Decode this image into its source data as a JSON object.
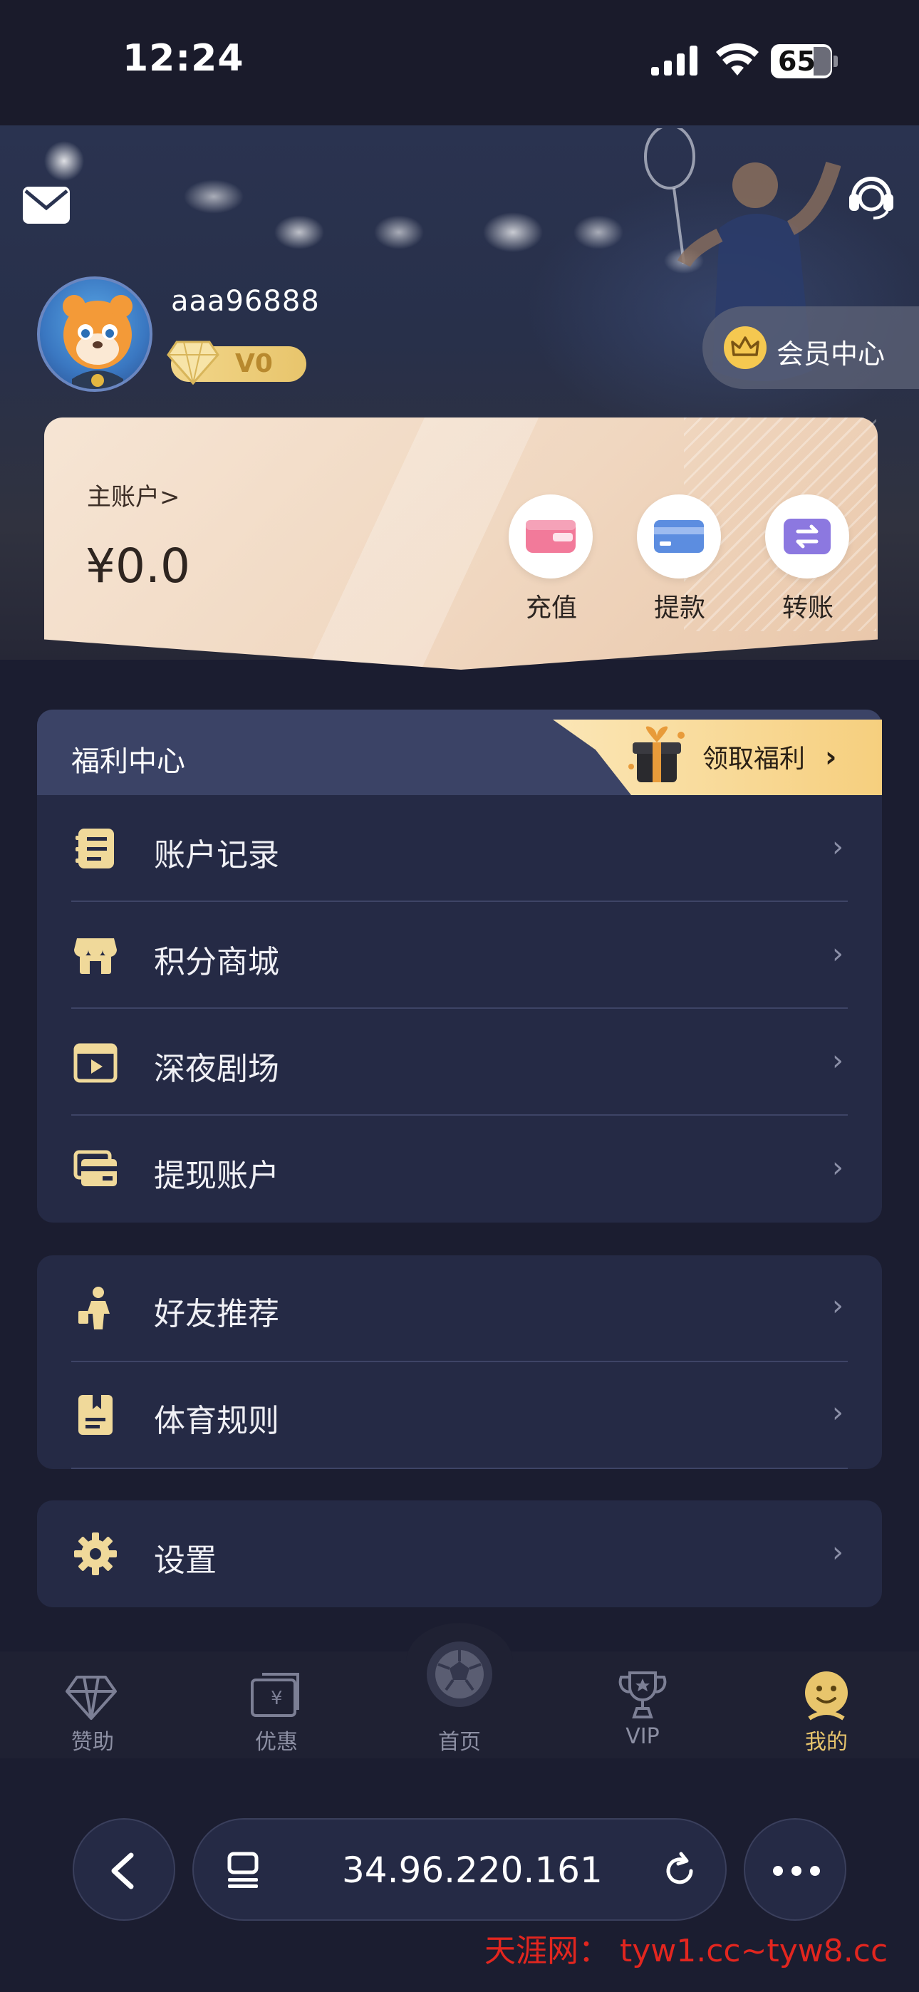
{
  "status_bar": {
    "time": "12:24",
    "battery": "65"
  },
  "profile": {
    "username": "aaa96888",
    "vip_level": "V0",
    "member_center_label": "会员中心"
  },
  "balance": {
    "account_label": "主账户>",
    "amount": "¥0.0",
    "actions": [
      {
        "label": "充值"
      },
      {
        "label": "提款"
      },
      {
        "label": "转账"
      }
    ]
  },
  "welfare": {
    "title": "福利中心",
    "claim_label": "领取福利",
    "items": [
      {
        "label": "账户记录",
        "icon": "ledger-icon"
      },
      {
        "label": "积分商城",
        "icon": "store-icon"
      },
      {
        "label": "深夜剧场",
        "icon": "film-icon"
      },
      {
        "label": "提现账户",
        "icon": "cards-icon"
      }
    ]
  },
  "more_menu": {
    "items": [
      {
        "label": "好友推荐",
        "icon": "person-icon"
      },
      {
        "label": "体育规则",
        "icon": "rulebook-icon"
      }
    ]
  },
  "settings": {
    "label": "设置"
  },
  "tabbar": {
    "items": [
      {
        "label": "赞助",
        "icon": "diamond-icon",
        "active": false
      },
      {
        "label": "优惠",
        "icon": "coupon-icon",
        "active": false
      },
      {
        "label": "首页",
        "icon": "soccer-ball-icon",
        "active": false
      },
      {
        "label": "VIP",
        "icon": "trophy-icon",
        "active": false
      },
      {
        "label": "我的",
        "icon": "smiley-icon",
        "active": true
      }
    ]
  },
  "browser": {
    "url": "34.96.220.161"
  },
  "watermark": "天涯网： tyw1.cc~tyw8.cc",
  "colors": {
    "accent_gold": "#e8c56c",
    "panel": "#252a45",
    "welfare_header": "#3b4366",
    "active_tab": "#e8c56c"
  }
}
